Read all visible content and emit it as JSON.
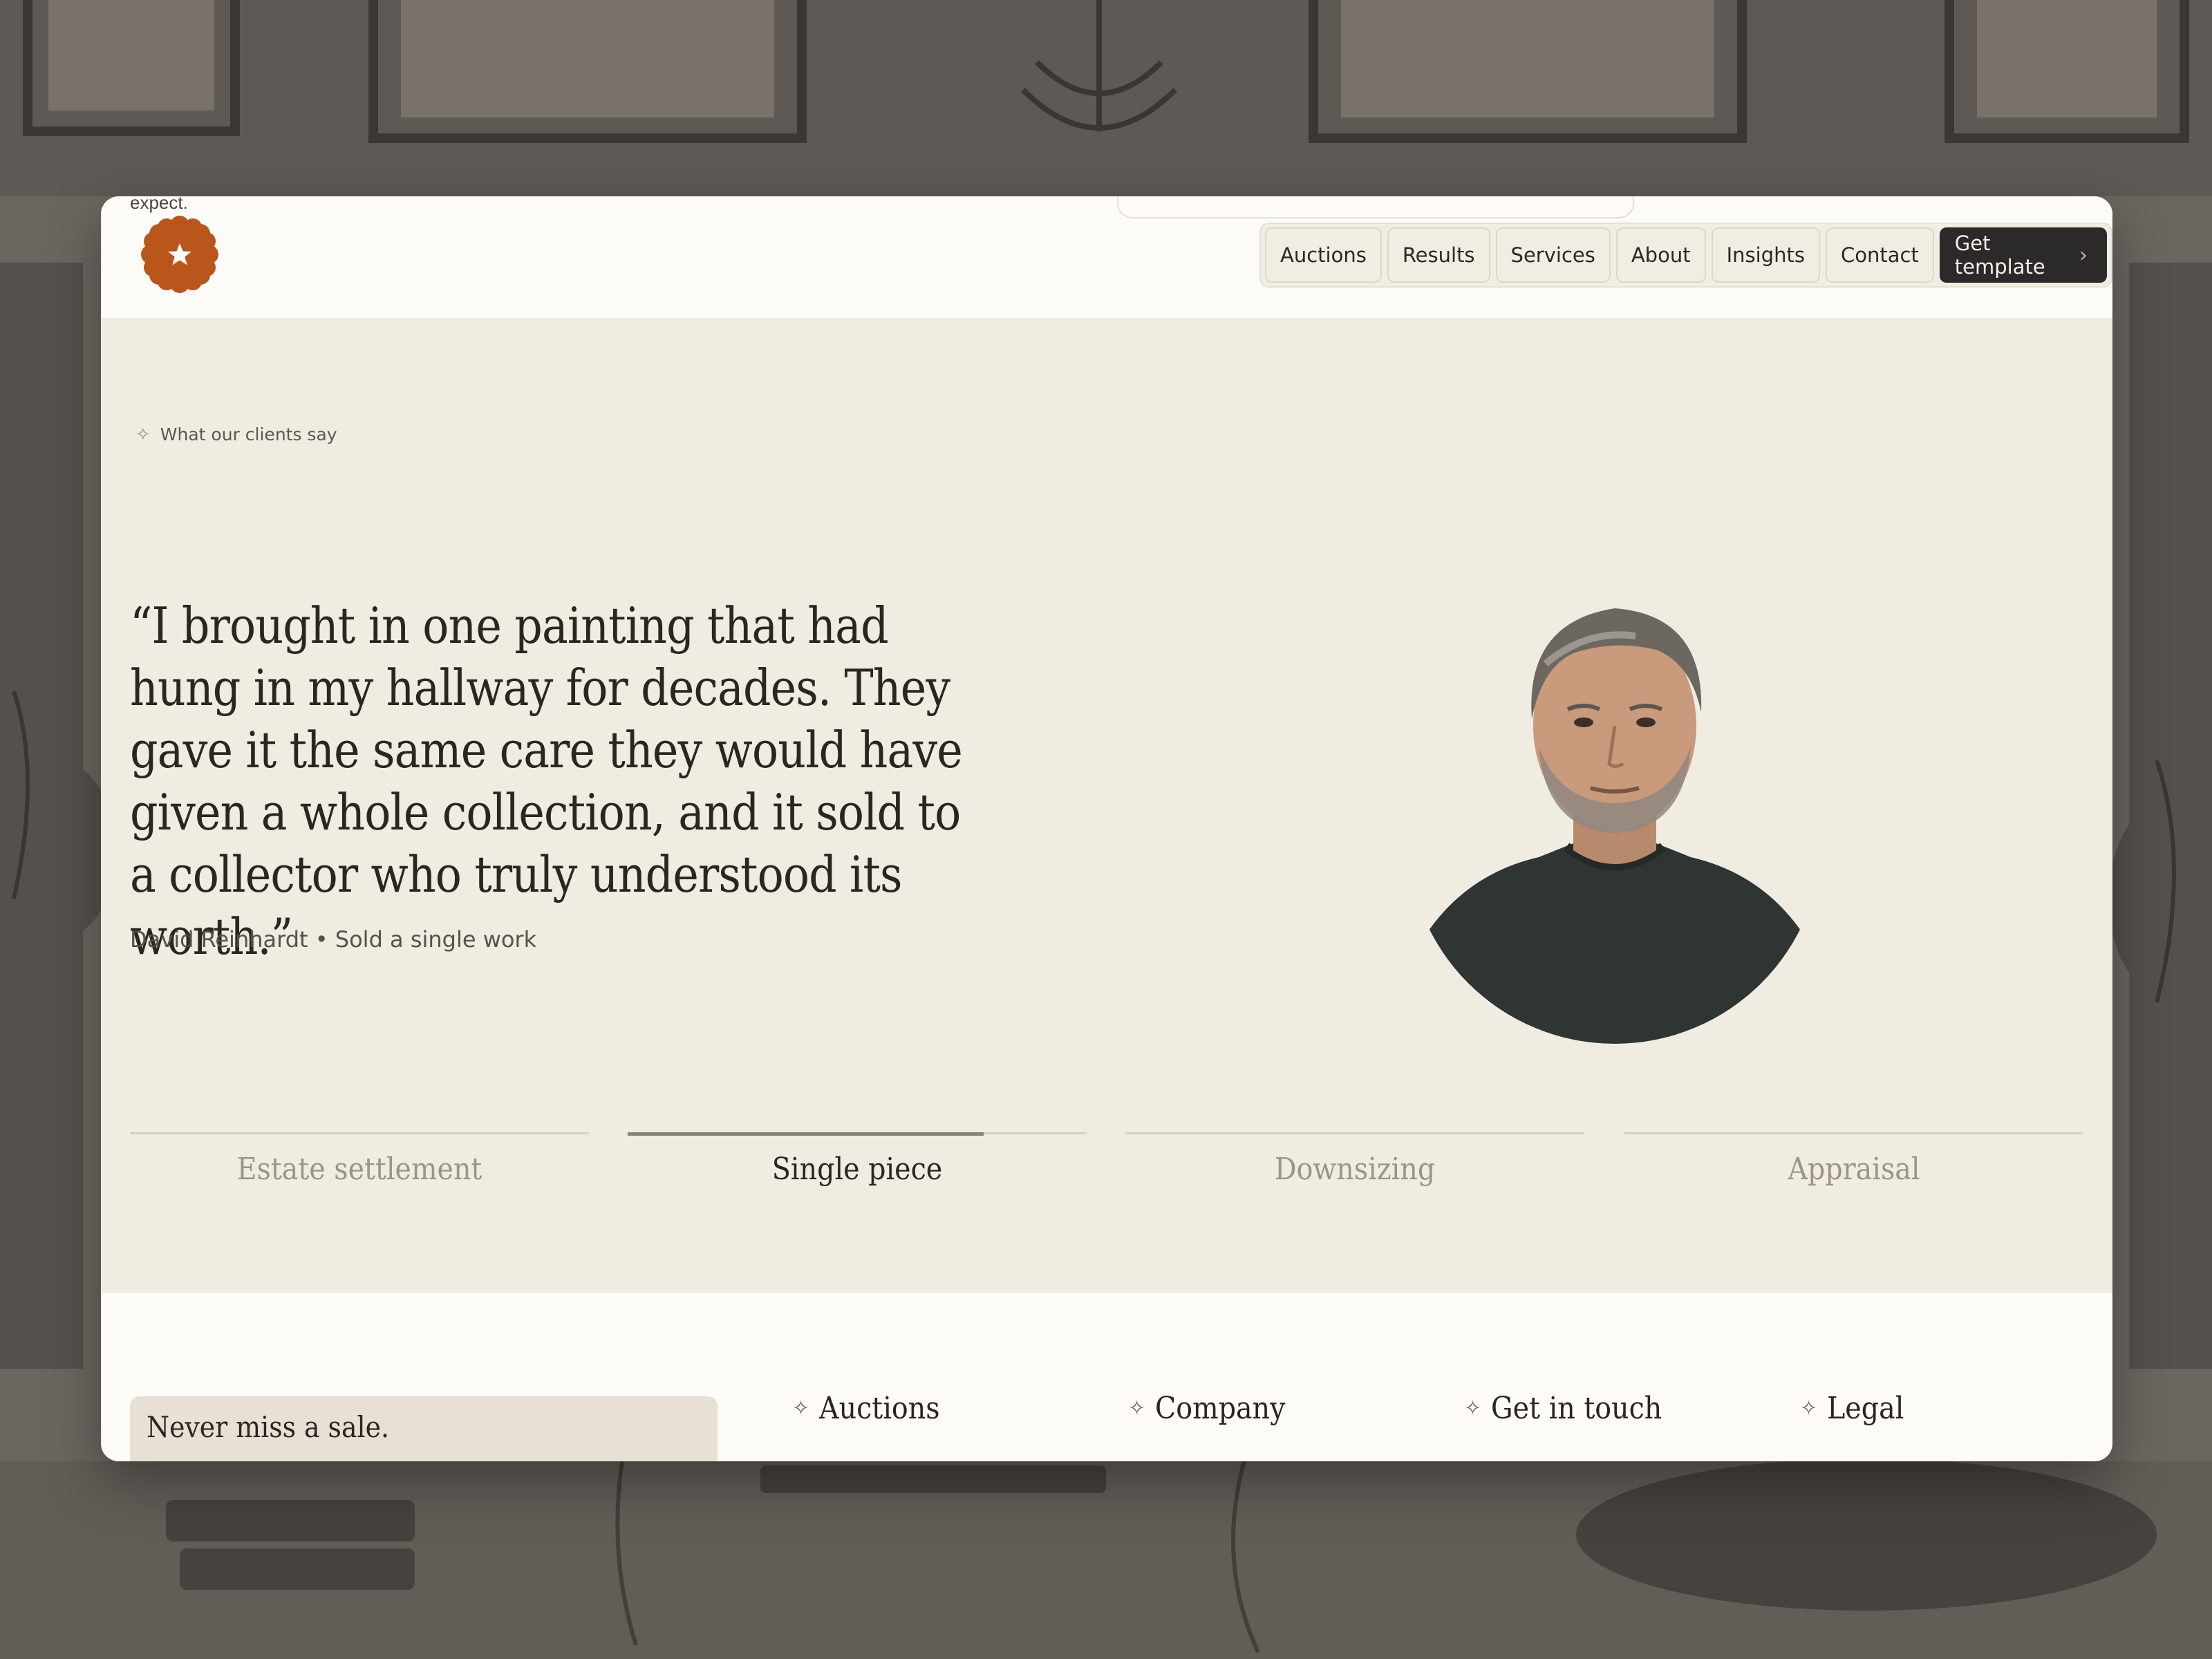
{
  "header": {
    "ghost_text": "expect.",
    "logo_icon": "star-flower-logo",
    "nav": [
      {
        "label": "Auctions"
      },
      {
        "label": "Results"
      },
      {
        "label": "Services"
      },
      {
        "label": "About"
      },
      {
        "label": "Insights"
      },
      {
        "label": "Contact"
      }
    ],
    "cta": {
      "label": "Get template",
      "icon": "chevron-right-icon"
    }
  },
  "testimonials": {
    "eyebrow": "What our clients say",
    "quote": "“I brought in one painting that had hung in my hallway for decades. They gave it the same care they would have given a whole collection, and it sold to a collector who truly understood its worth.”",
    "author": "David Reinhardt • Sold a single work",
    "tabs": [
      {
        "label": "Estate settlement",
        "active": false
      },
      {
        "label": "Single piece",
        "active": true
      },
      {
        "label": "Downsizing",
        "active": false
      },
      {
        "label": "Appraisal",
        "active": false
      }
    ]
  },
  "footer": {
    "newsletter_heading": "Never miss a sale.",
    "columns": [
      {
        "title": "Auctions"
      },
      {
        "title": "Company"
      },
      {
        "title": "Get in touch"
      },
      {
        "title": "Legal"
      }
    ]
  },
  "colors": {
    "accent": "#b8561b",
    "cta_bg": "#2b2a29",
    "section_bg": "#f1ece2",
    "page_bg": "#fdfbf7"
  }
}
